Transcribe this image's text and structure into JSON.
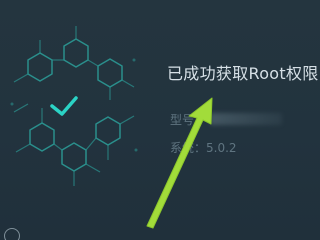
{
  "status": {
    "title": "已成功获取Root权限",
    "check_icon": "check-icon",
    "accent_color": "#2bd3c5"
  },
  "device": {
    "model_label": "型号：",
    "model_value_hidden": true,
    "system_label": "系统",
    "system_version": "：5.0.2"
  },
  "annotation": {
    "arrow_color": "#a2dc3a",
    "arrow_icon": "annotation-arrow-icon"
  },
  "footer": {
    "icon": "circle-icon",
    "text": ""
  }
}
